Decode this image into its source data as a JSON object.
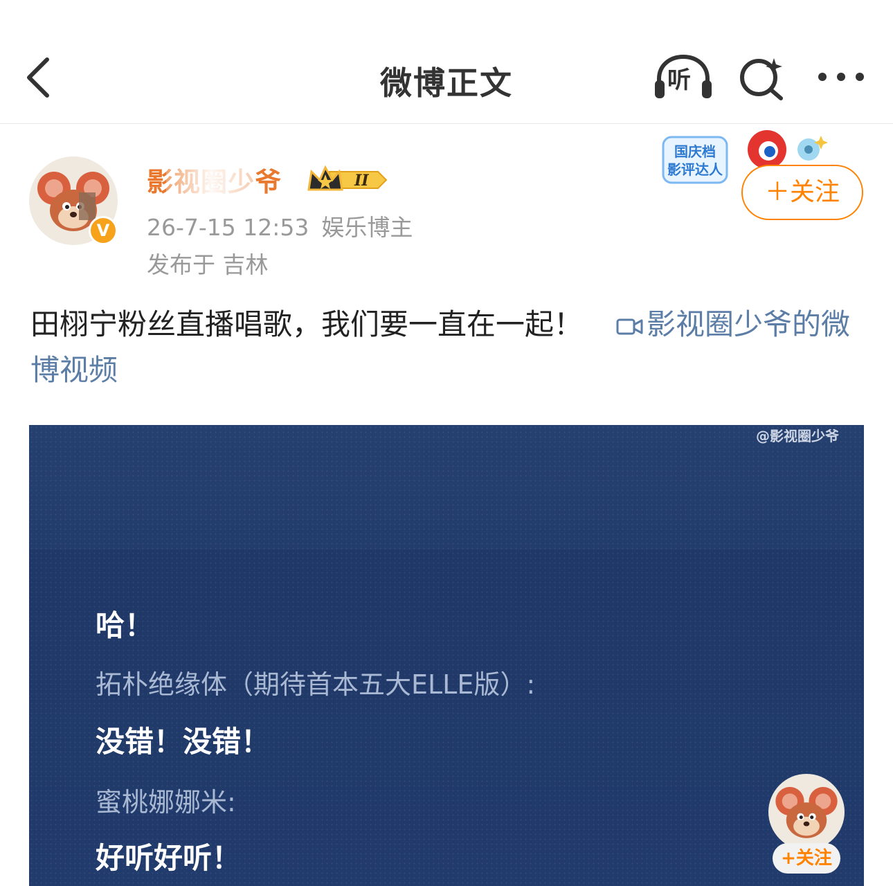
{
  "nav": {
    "title": "微博正文",
    "listen_label": "听"
  },
  "author": {
    "name": "影视圈少爷",
    "rank": "II",
    "verified_badge": "V",
    "time": "26-7-15 12:53",
    "role": "娱乐博主",
    "location": "发布于 吉林",
    "promo_line1": "国庆档",
    "promo_line2": "影评达人",
    "follow_label": "＋关注"
  },
  "post": {
    "text": "田栩宁粉丝直播唱歌，我们要一直在一起！",
    "video_link": "影视圈少爷的微博视频"
  },
  "video": {
    "watermark": "@影视圈少爷",
    "lines": [
      "哈！",
      "拓朴绝缘体（期待首本五大ELLE版）:",
      "没错！没错！",
      "蜜桃娜娜米:",
      "好听好听！"
    ],
    "follow_label": "+关注"
  },
  "colors": {
    "accent": "#ff8200",
    "link": "#5c7ea6",
    "username": "#e8792f",
    "video_bg": "#213b6b"
  },
  "icons": [
    "back-chevron-icon",
    "headphones-icon",
    "search-sparkle-icon",
    "more-icon",
    "video-camera-icon",
    "crown-icon"
  ]
}
